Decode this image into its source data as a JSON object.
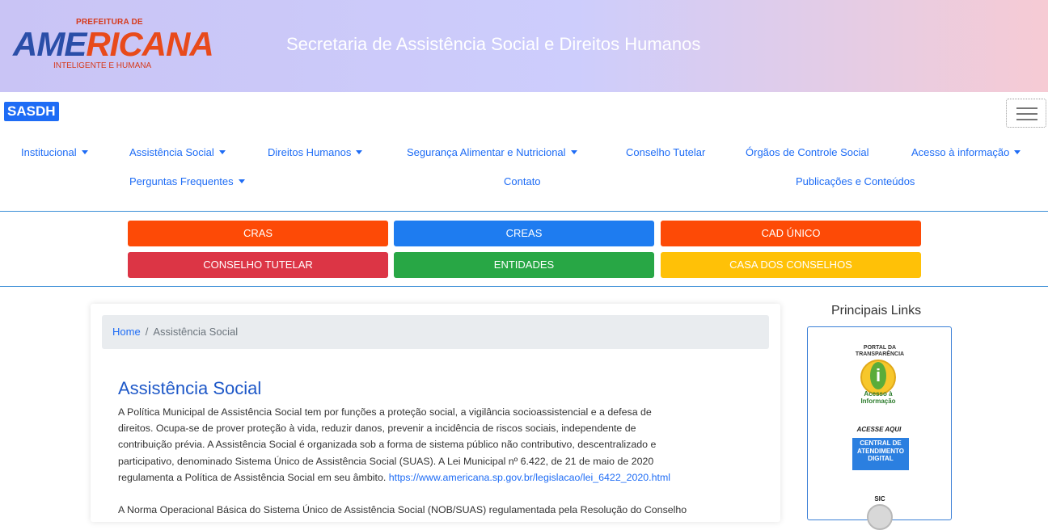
{
  "header": {
    "logo_top": "PREFEITURA DE",
    "logo_word_a": "AME",
    "logo_word_b": "RICANA",
    "logo_tagline": "INTELIGENTE E HUMANA",
    "title": "Secretaria de Assistência Social e Direitos Humanos"
  },
  "navbar": {
    "brand": "SASDH",
    "toggler_icon": "hamburger-menu-icon",
    "items": [
      {
        "label": "Institucional",
        "dropdown": true
      },
      {
        "label": "Assistência Social",
        "dropdown": true
      },
      {
        "label": "Direitos Humanos",
        "dropdown": true
      },
      {
        "label": "Segurança Alimentar e Nutricional",
        "dropdown": true
      },
      {
        "label": "Conselho Tutelar",
        "dropdown": false
      },
      {
        "label": "Órgãos de Controle Social",
        "dropdown": false
      },
      {
        "label": "Acesso à informação",
        "dropdown": true
      },
      {
        "label": "Perguntas Frequentes",
        "dropdown": true
      },
      {
        "label": "Contato",
        "dropdown": false
      },
      {
        "label": "Publicações e Conteúdos",
        "dropdown": false
      }
    ]
  },
  "quick_buttons": [
    {
      "label": "CRAS",
      "color": "#fd4a06"
    },
    {
      "label": "CREAS",
      "color": "#1e7cf0"
    },
    {
      "label": "CAD ÚNICO",
      "color": "#fd4a06"
    },
    {
      "label": "CONSELHO TUTELAR",
      "color": "#dc3545"
    },
    {
      "label": "ENTIDADES",
      "color": "#28a745"
    },
    {
      "label": "CASA DOS CONSELHOS",
      "color": "#ffc107"
    }
  ],
  "breadcrumb": {
    "home": "Home",
    "separator": "/",
    "current": "Assistência Social"
  },
  "content": {
    "title": "Assistência Social",
    "paragraph1_lines": [
      "A Política Municipal de Assistência Social  tem por funções a proteção social, a vigilância socioassistencial e a defesa de",
      "direitos. Ocupa-se de prover proteção à vida, reduzir danos, prevenir a incidência de riscos sociais, independente de",
      "contribuição prévia. A Assistência Social é organizada sob a forma de sistema público não contributivo, descentralizado e",
      "participativo, denominado Sistema Único de Assistência Social (SUAS). A Lei Municipal nº 6.422, de 21 de maio de 2020",
      "regulamenta a Política de Assistência Social em seu âmbito."
    ],
    "law_link": "https://www.americana.sp.gov.br/legislacao/lei_6422_2020.html",
    "paragraph2_start": "A Norma Operacional Básica do Sistema Único de Assistência Social (NOB/SUAS) regulamentada pela Resolução do Conselho"
  },
  "sidebar": {
    "title": "Principais Links",
    "portal_label_1": "PORTAL DA",
    "portal_label_2": "TRANSPARÊNCIA",
    "info_icon": "info-icon",
    "info_glyph": "i",
    "acesso_label_1": "Acesso à",
    "acesso_label_2": "Informação",
    "acesse_aqui": "ACESSE AQUI",
    "central_lines": [
      "CENTRAL DE",
      "ATENDIMENTO",
      "DIGITAL"
    ],
    "sic_label": "SIC"
  }
}
